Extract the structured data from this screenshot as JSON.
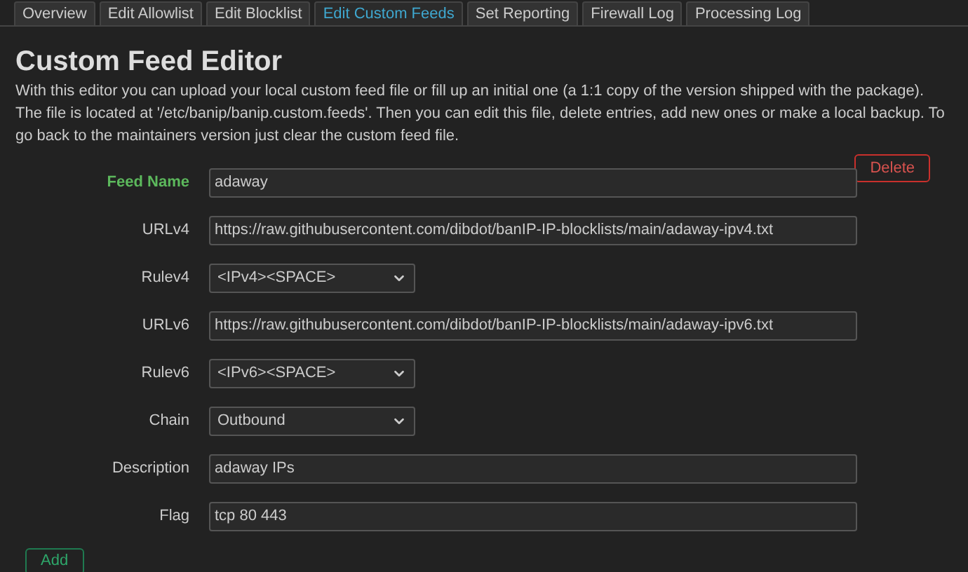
{
  "tabs": [
    {
      "label": "Overview",
      "selected": false
    },
    {
      "label": "Edit Allowlist",
      "selected": false
    },
    {
      "label": "Edit Blocklist",
      "selected": false
    },
    {
      "label": "Edit Custom Feeds",
      "selected": true
    },
    {
      "label": "Set Reporting",
      "selected": false
    },
    {
      "label": "Firewall Log",
      "selected": false
    },
    {
      "label": "Processing Log",
      "selected": false
    }
  ],
  "title": "Custom Feed Editor",
  "description": "With this editor you can upload your local custom feed file or fill up an initial one (a 1:1 copy of the version shipped with the package). The file is located at '/etc/banip/banip.custom.feeds'. Then you can edit this file, delete entries, add new ones or make a local backup. To go back to the maintainers version just clear the custom feed file.",
  "delete_button": "Delete",
  "fields": [
    {
      "label": "Feed Name",
      "kind": "text",
      "value": "adaway",
      "highlighted": true
    },
    {
      "label": "URLv4",
      "kind": "text",
      "value": "https://raw.githubusercontent.com/dibdot/banIP-IP-blocklists/main/adaway-ipv4.txt",
      "highlighted": false
    },
    {
      "label": "Rulev4",
      "kind": "select",
      "value": "<IPv4><SPACE>",
      "highlighted": false
    },
    {
      "label": "URLv6",
      "kind": "text",
      "value": "https://raw.githubusercontent.com/dibdot/banIP-IP-blocklists/main/adaway-ipv6.txt",
      "highlighted": false
    },
    {
      "label": "Rulev6",
      "kind": "select",
      "value": "<IPv6><SPACE>",
      "highlighted": false
    },
    {
      "label": "Chain",
      "kind": "select",
      "value": "Outbound",
      "highlighted": false
    },
    {
      "label": "Description",
      "kind": "text",
      "value": "adaway IPs",
      "highlighted": false
    },
    {
      "label": "Flag",
      "kind": "text",
      "value": "tcp 80 443",
      "highlighted": false
    }
  ],
  "add_button": "Add"
}
